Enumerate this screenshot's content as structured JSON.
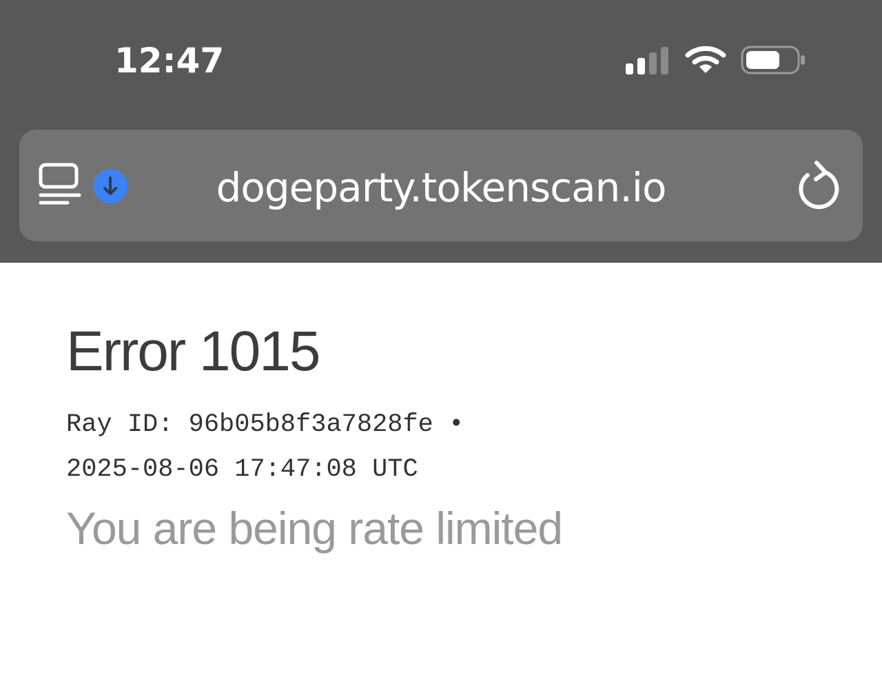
{
  "status_bar": {
    "time": "12:47",
    "icons": [
      "signal-icon",
      "wifi-icon",
      "battery-icon"
    ]
  },
  "address_bar": {
    "url": "dogeparty.tokenscan.io",
    "icons": [
      "reader-mode-icon",
      "download-icon",
      "reload-icon"
    ],
    "download_color": "#3b82f6"
  },
  "page": {
    "error_title": "Error 1015",
    "ray_id_line": "Ray ID: 96b05b8f3a7828fe •",
    "timestamp_line": "2025-08-06 17:47:08 UTC",
    "message": "You are being rate limited"
  },
  "colors": {
    "chrome_bg": "#585858",
    "address_bar_bg": "#737373",
    "title_color": "#3c3c3c",
    "message_color": "#9a9a9a"
  }
}
